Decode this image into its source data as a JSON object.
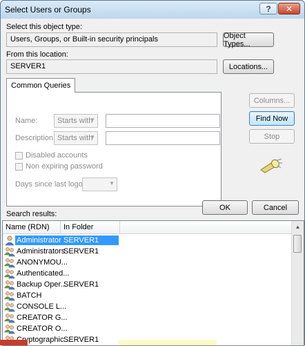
{
  "window": {
    "title": "Select Users or Groups",
    "help_label": "?",
    "close_label": "✕"
  },
  "object_type": {
    "label": "Select this object type:",
    "value": "Users, Groups, or Built-in security principals",
    "button": "Object Types..."
  },
  "location": {
    "label": "From this location:",
    "value": "SERVER1",
    "button": "Locations..."
  },
  "queries": {
    "tab_label": "Common Queries",
    "name_label": "Name:",
    "name_mode": "Starts with",
    "description_label": "Description:",
    "description_mode": "Starts with",
    "disabled_accounts": "Disabled accounts",
    "non_expiring": "Non expiring password",
    "days_label": "Days since last logon:"
  },
  "side_buttons": {
    "columns": "Columns...",
    "find_now": "Find Now",
    "stop": "Stop"
  },
  "ok": "OK",
  "cancel": "Cancel",
  "results": {
    "label": "Search results:",
    "columns": [
      "Name (RDN)",
      "In Folder"
    ],
    "rows": [
      {
        "name": "Administrator",
        "folder": "SERVER1",
        "icon": "user-icon"
      },
      {
        "name": "Administrators",
        "folder": "SERVER1",
        "icon": "group-icon"
      },
      {
        "name": "ANONYMOU...",
        "folder": "",
        "icon": "group-icon"
      },
      {
        "name": "Authenticated...",
        "folder": "",
        "icon": "group-icon"
      },
      {
        "name": "Backup Oper...",
        "folder": "SERVER1",
        "icon": "group-icon"
      },
      {
        "name": "BATCH",
        "folder": "",
        "icon": "group-icon"
      },
      {
        "name": "CONSOLE L...",
        "folder": "",
        "icon": "group-icon"
      },
      {
        "name": "CREATOR G...",
        "folder": "",
        "icon": "group-icon"
      },
      {
        "name": "CREATOR O...",
        "folder": "",
        "icon": "group-icon"
      },
      {
        "name": "Cryptographic...",
        "folder": "SERVER1",
        "icon": "group-icon"
      }
    ]
  },
  "colors": {
    "selection": "#3399ff",
    "frame": "#bcd7ec",
    "client": "#f0f0f0"
  }
}
